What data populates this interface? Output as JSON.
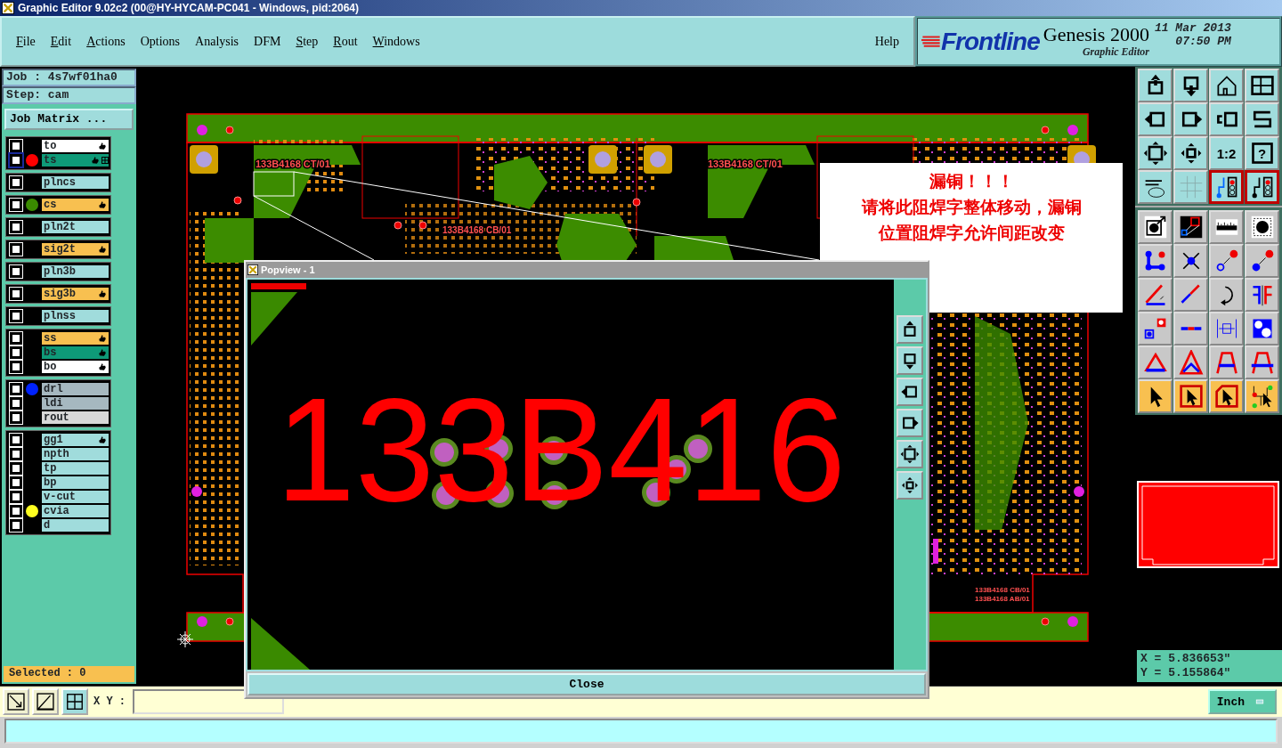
{
  "window": {
    "title": "Graphic Editor 9.02c2 (00@HY-HYCAM-PC041 - Windows, pid:2064)"
  },
  "menu": [
    {
      "label": "File",
      "mnemonic": true
    },
    {
      "label": "Edit",
      "mnemonic": true
    },
    {
      "label": "Actions",
      "mnemonic": true
    },
    {
      "label": "Options",
      "mnemonic": false
    },
    {
      "label": "Analysis",
      "mnemonic": false
    },
    {
      "label": "DFM",
      "mnemonic": false
    },
    {
      "label": "Step",
      "mnemonic": true
    },
    {
      "label": "Rout",
      "mnemonic": true
    },
    {
      "label": "Windows",
      "mnemonic": true
    }
  ],
  "help": "Help",
  "brand": {
    "logo": "Frontline",
    "product": "Genesis 2000",
    "subtitle": "Graphic Editor",
    "date": "11 Mar 2013",
    "time": "07:50 PM"
  },
  "job": "Job : 4s7wf01ha0",
  "step": "Step: cam",
  "job_matrix": "Job Matrix ...",
  "layer_groups": [
    [
      {
        "name": "to",
        "kind": "white",
        "checked": false,
        "affected": true,
        "selected": false
      },
      {
        "name": "ts",
        "kind": "teal",
        "checked": false,
        "affected": true,
        "selected": true,
        "color": "#ff0000"
      }
    ],
    [
      {
        "name": "plncs",
        "kind": "plain",
        "checked": false,
        "affected": false,
        "selected": false
      }
    ],
    [
      {
        "name": "cs",
        "kind": "orange",
        "checked": false,
        "affected": true,
        "selected": false,
        "color": "#3a8a00"
      }
    ],
    [
      {
        "name": "pln2t",
        "kind": "plain",
        "checked": false,
        "affected": false,
        "selected": false
      }
    ],
    [
      {
        "name": "sig2t",
        "kind": "orange",
        "checked": false,
        "affected": true,
        "selected": false
      }
    ],
    [
      {
        "name": "pln3b",
        "kind": "plain",
        "checked": false,
        "affected": false,
        "selected": false
      }
    ],
    [
      {
        "name": "sig3b",
        "kind": "orange",
        "checked": false,
        "affected": true,
        "selected": false
      }
    ],
    [
      {
        "name": "plnss",
        "kind": "plain",
        "checked": false,
        "affected": false,
        "selected": false
      }
    ],
    [
      {
        "name": "ss",
        "kind": "orange",
        "checked": false,
        "affected": true,
        "selected": false
      },
      {
        "name": "bs",
        "kind": "teal",
        "checked": false,
        "affected": true,
        "selected": false
      },
      {
        "name": "bo",
        "kind": "white",
        "checked": false,
        "affected": true,
        "selected": false
      }
    ],
    [
      {
        "name": "drl",
        "kind": "grey",
        "checked": false,
        "affected": false,
        "selected": false,
        "color": "#0022ff"
      },
      {
        "name": "ldi",
        "kind": "grey",
        "checked": false,
        "affected": false,
        "selected": false
      },
      {
        "name": "rout",
        "kind": "silver",
        "checked": false,
        "affected": false,
        "selected": false
      }
    ],
    [
      {
        "name": "gg1",
        "kind": "plain",
        "checked": false,
        "affected": true,
        "selected": false
      },
      {
        "name": "npth",
        "kind": "plain",
        "checked": false,
        "affected": false,
        "selected": false
      },
      {
        "name": "tp",
        "kind": "plain",
        "checked": false,
        "affected": false,
        "selected": false
      },
      {
        "name": "bp",
        "kind": "plain",
        "checked": false,
        "affected": false,
        "selected": false
      },
      {
        "name": "v-cut",
        "kind": "plain",
        "checked": false,
        "affected": false,
        "selected": false
      },
      {
        "name": "cvia",
        "kind": "plain",
        "checked": false,
        "affected": false,
        "selected": false,
        "color": "#ffff20"
      },
      {
        "name": "d",
        "kind": "plain",
        "checked": false,
        "affected": false,
        "selected": false
      }
    ]
  ],
  "selected_count": "Selected : 0",
  "board_labels": [
    "133B4168 CT/01",
    "133B4168 CT/01",
    "133B4168 CB/01",
    "133B4168 CB/01",
    "133B4168 AB/01"
  ],
  "note": {
    "title": "漏铜！！！",
    "lines": [
      "请将此阻焊字整体移动，漏铜",
      "位置阻焊字允许间距改变"
    ]
  },
  "popview": {
    "title": "Popview - 1",
    "text": "133B416",
    "close": "Close"
  },
  "toolbar": [
    {
      "kind": "view",
      "selected": false
    },
    {
      "kind": "view",
      "selected": false
    },
    {
      "kind": "view",
      "selected": false
    },
    {
      "kind": "view",
      "selected": false
    },
    {
      "kind": "view",
      "selected": false
    },
    {
      "kind": "view",
      "selected": false
    },
    {
      "kind": "view",
      "selected": false
    },
    {
      "kind": "view",
      "selected": false
    },
    {
      "kind": "view",
      "selected": false
    },
    {
      "kind": "view",
      "selected": false
    },
    {
      "kind": "view",
      "selected": false,
      "label": "1:2"
    },
    {
      "kind": "view",
      "selected": false,
      "label": "?"
    },
    {
      "kind": "view",
      "selected": false
    },
    {
      "kind": "view",
      "selected": false
    },
    {
      "kind": "view",
      "selected": true
    },
    {
      "kind": "view",
      "selected": true
    },
    {
      "kind": "edit",
      "selected": false
    },
    {
      "kind": "edit",
      "selected": false
    },
    {
      "kind": "edit",
      "selected": false
    },
    {
      "kind": "edit",
      "selected": false
    },
    {
      "kind": "edit",
      "selected": false
    },
    {
      "kind": "edit",
      "selected": false
    },
    {
      "kind": "edit",
      "selected": false
    },
    {
      "kind": "edit",
      "selected": false
    },
    {
      "kind": "edit",
      "selected": false
    },
    {
      "kind": "edit",
      "selected": false
    },
    {
      "kind": "edit",
      "selected": false
    },
    {
      "kind": "edit",
      "selected": false
    },
    {
      "kind": "edit",
      "selected": false
    },
    {
      "kind": "edit",
      "selected": false
    },
    {
      "kind": "edit",
      "selected": false
    },
    {
      "kind": "edit",
      "selected": false
    },
    {
      "kind": "edit",
      "selected": false
    },
    {
      "kind": "edit",
      "selected": false
    },
    {
      "kind": "edit",
      "selected": false
    },
    {
      "kind": "edit",
      "selected": false
    },
    {
      "kind": "select",
      "selected": false
    },
    {
      "kind": "select",
      "selected": false
    },
    {
      "kind": "select",
      "selected": false
    },
    {
      "kind": "select",
      "selected": false
    }
  ],
  "coords": {
    "x": "X = 5.836653\"",
    "y": "Y = 5.155864\""
  },
  "xy_label": "X Y :",
  "unit": "Inch"
}
